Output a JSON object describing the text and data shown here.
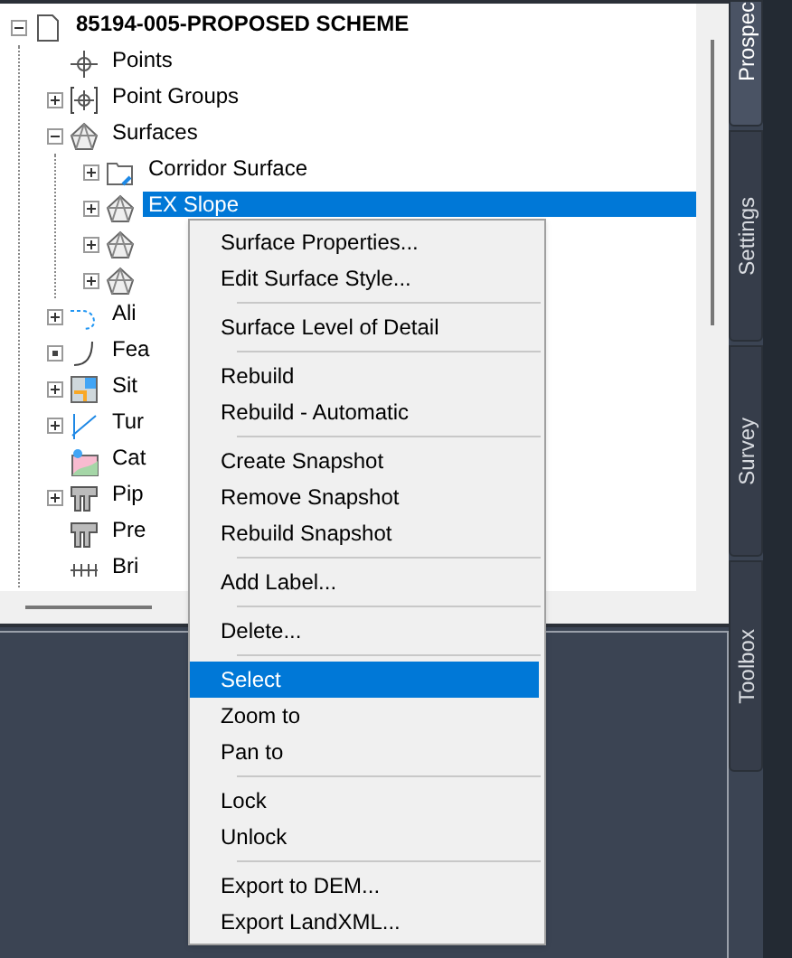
{
  "tree": {
    "label": "85194-005-PROPOSED SCHEME",
    "kind": "drawing",
    "expanded": true,
    "selected": false,
    "children": [
      {
        "label": "Points",
        "kind": "point",
        "selected": false
      },
      {
        "label": "Point Groups",
        "kind": "point-group",
        "expanded": false,
        "selected": false
      },
      {
        "label": "Surfaces",
        "kind": "surface",
        "expanded": true,
        "selected": false,
        "children": [
          {
            "label": "Corridor Surface",
            "kind": "folder",
            "expanded": false,
            "selected": false
          },
          {
            "label": "EX Slope",
            "kind": "surface",
            "expanded": false,
            "selected": true
          },
          {
            "kind": "surface",
            "expanded": false
          },
          {
            "kind": "surface",
            "expanded": false
          }
        ]
      },
      {
        "label": "Ali",
        "kind": "alignment",
        "expanded": false,
        "selected": false
      },
      {
        "label": "Fea",
        "kind": "feature-line",
        "expanded": false,
        "empty": true,
        "selected": false
      },
      {
        "label": "Sit",
        "kind": "site",
        "expanded": false,
        "selected": false
      },
      {
        "label": "Tur",
        "kind": "turn",
        "expanded": false,
        "selected": false
      },
      {
        "label": "Cat",
        "kind": "catchment",
        "selected": false
      },
      {
        "label": "Pip",
        "kind": "pipe",
        "expanded": false,
        "selected": false
      },
      {
        "label": "Pre",
        "kind": "pipe",
        "selected": false
      },
      {
        "label": "Bri",
        "kind": "bridge",
        "selected": false
      }
    ]
  },
  "context_menu": [
    [
      {
        "label": "Surface Properties...",
        "selected": false
      },
      {
        "label": "Edit Surface Style...",
        "selected": false
      }
    ],
    [
      {
        "label": "Surface Level of Detail",
        "selected": false
      }
    ],
    [
      {
        "label": "Rebuild",
        "selected": false
      },
      {
        "label": "Rebuild - Automatic",
        "selected": false
      }
    ],
    [
      {
        "label": "Create Snapshot",
        "selected": false
      },
      {
        "label": "Remove Snapshot",
        "selected": false
      },
      {
        "label": "Rebuild Snapshot",
        "selected": false
      }
    ],
    [
      {
        "label": "Add Label...",
        "selected": false
      }
    ],
    [
      {
        "label": "Delete...",
        "selected": false
      }
    ],
    [
      {
        "label": "Select",
        "selected": true
      },
      {
        "label": "Zoom to",
        "selected": false
      },
      {
        "label": "Pan to",
        "selected": false
      }
    ],
    [
      {
        "label": "Lock",
        "selected": false
      },
      {
        "label": "Unlock",
        "selected": false
      }
    ],
    [
      {
        "label": "Export to DEM...",
        "selected": false
      },
      {
        "label": "Export LandXML...",
        "selected": false
      }
    ]
  ],
  "side_tabs": [
    {
      "label": "Prospec",
      "selected": true
    },
    {
      "label": "Settings",
      "selected": false
    },
    {
      "label": "Survey",
      "selected": false
    },
    {
      "label": "Toolbox",
      "selected": false
    }
  ]
}
